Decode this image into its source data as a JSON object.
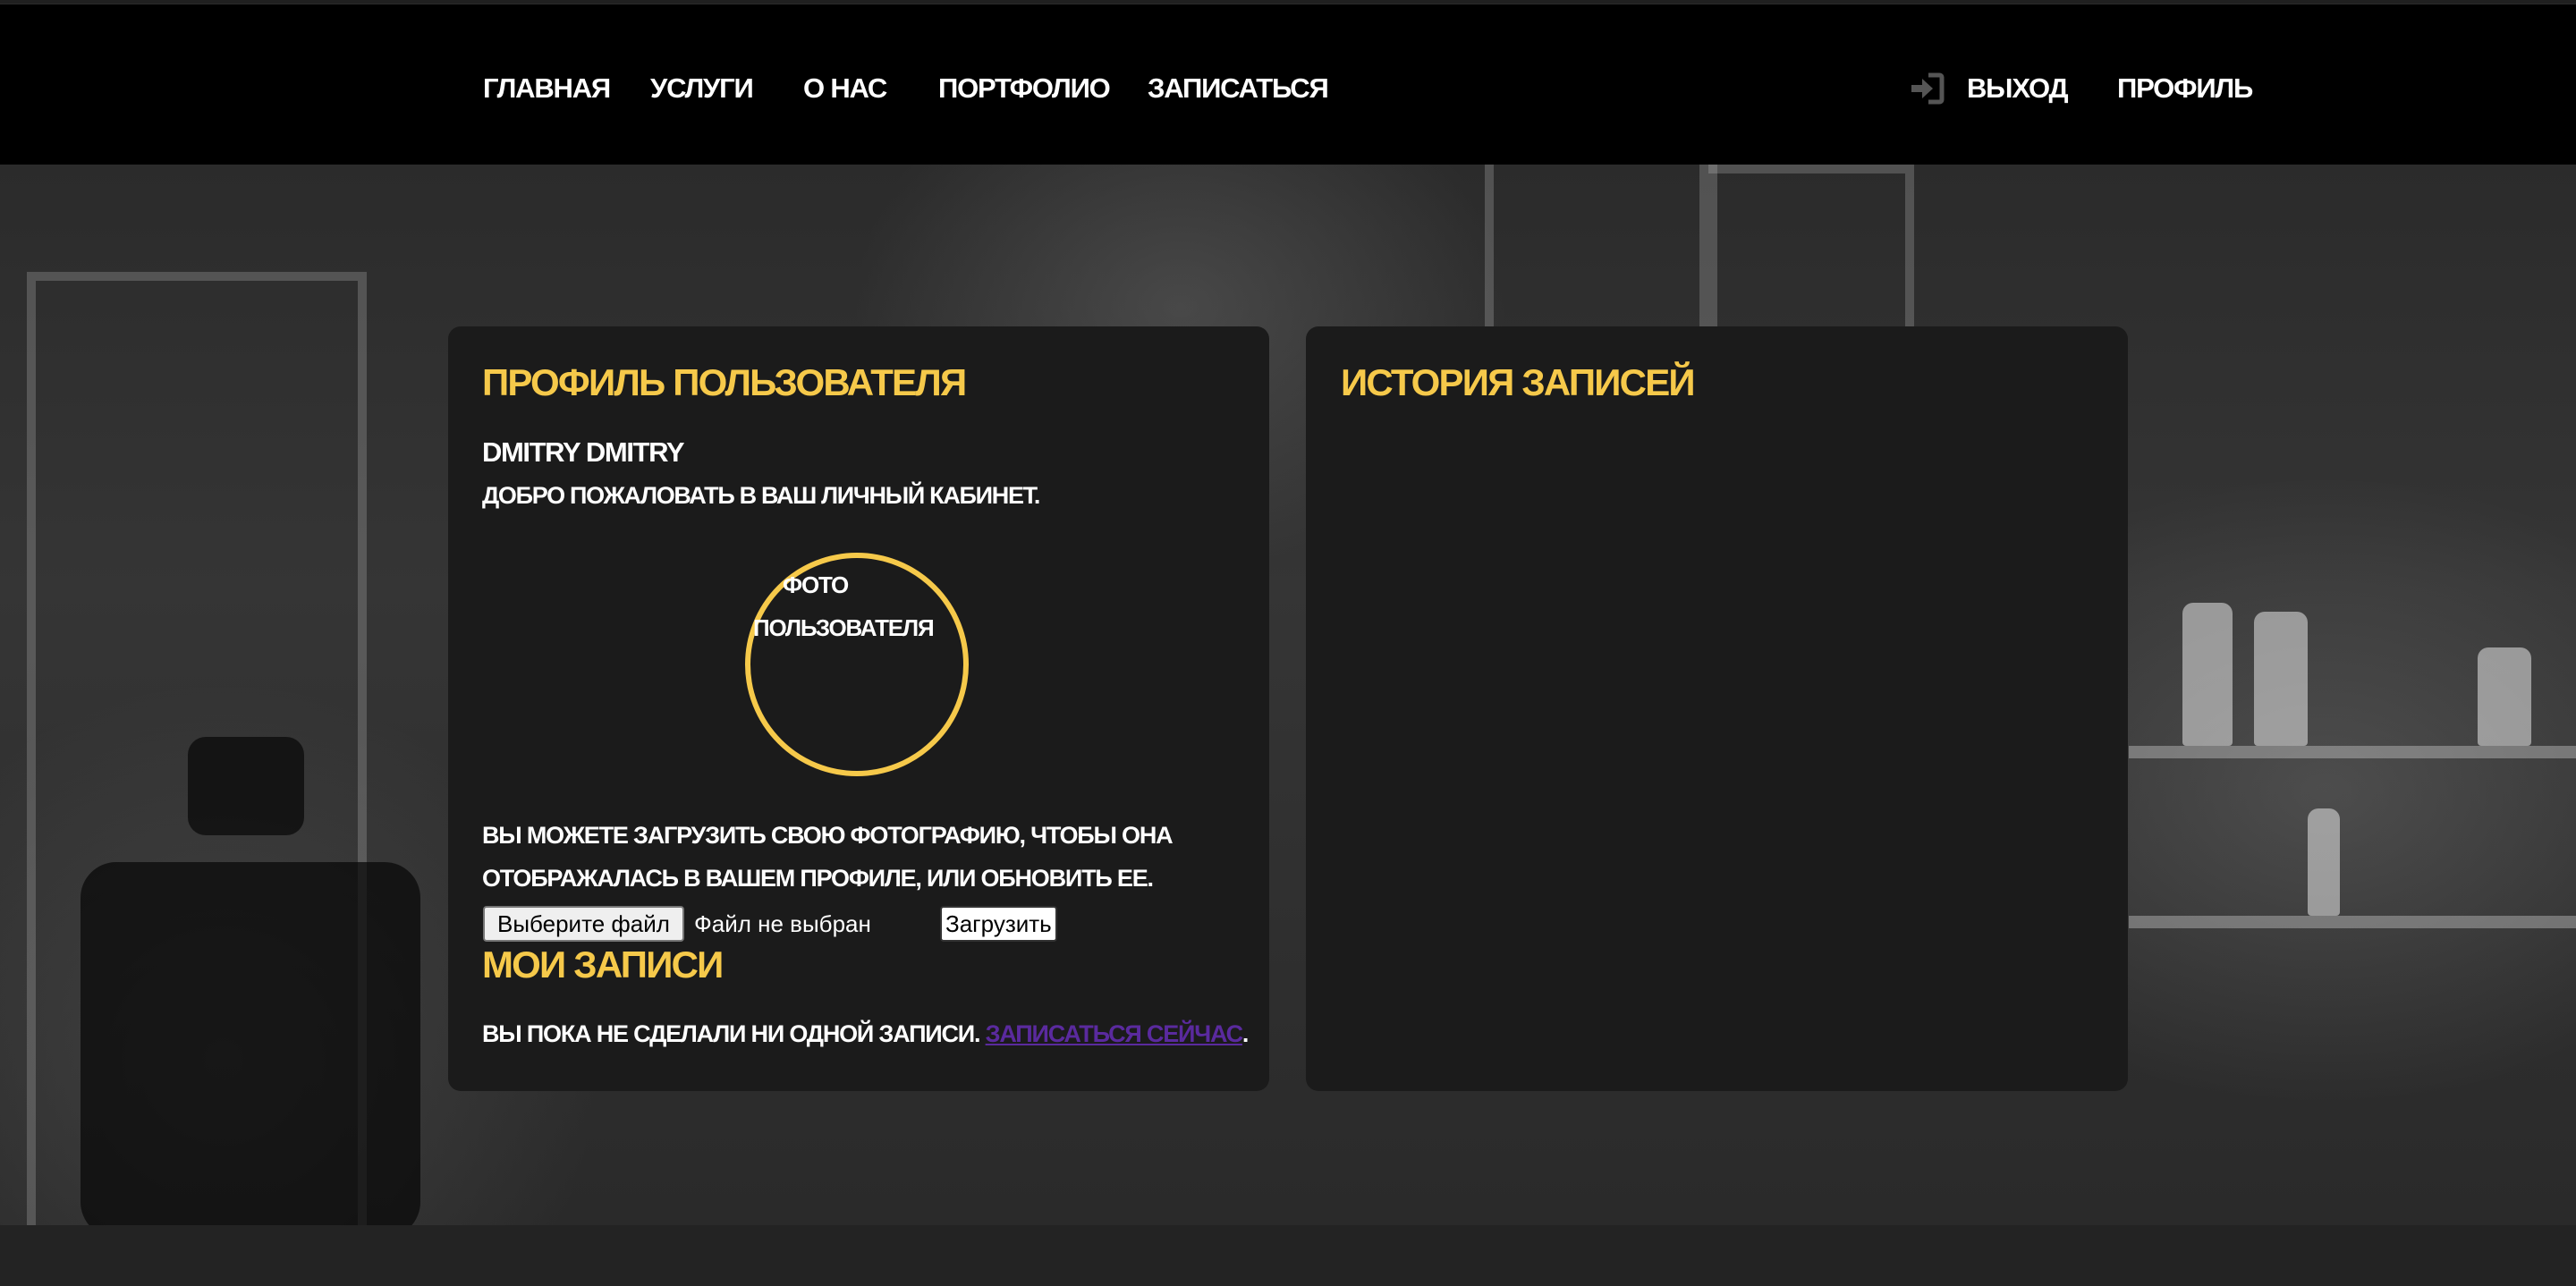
{
  "header": {
    "nav": [
      {
        "label": "ГЛАВНАЯ"
      },
      {
        "label": "УСЛУГИ"
      },
      {
        "label": "О НАС"
      },
      {
        "label": "ПОРТФОЛИО"
      },
      {
        "label": "ЗАПИСАТЬСЯ"
      }
    ],
    "logout_icon": "sign-in-arrow-icon",
    "logout_label": "ВЫХОД",
    "profile_label": "ПРОФИЛЬ"
  },
  "profile_card": {
    "title": "ПРОФИЛЬ ПОЛЬЗОВАТЕЛЯ",
    "user_name": "DMITRY DMITRY",
    "welcome": "ДОБРО ПОЖАЛОВАТЬ В ВАШ ЛИЧНЫЙ КАБИНЕТ.",
    "photo_alt_line1": "ФОТО",
    "photo_alt_line2": "ПОЛЬЗОВАТЕЛЯ",
    "upload_description": "ВЫ МОЖЕТЕ ЗАГРУЗИТЬ СВОЮ ФОТОГРАФИЮ, ЧТОБЫ ОНА ОТОБРАЖАЛАСЬ В ВАШЕМ ПРОФИЛЕ, ИЛИ ОБНОВИТЬ ЕЕ.",
    "choose_file_label": "Выберите файл",
    "no_file_text": "Файл не выбран",
    "upload_label": "Загрузить",
    "my_records_title": "МОИ ЗАПИСИ",
    "no_records_text": "ВЫ ПОКА НЕ СДЕЛАЛИ НИ ОДНОЙ ЗАПИСИ.",
    "book_now_link": "ЗАПИСАТЬСЯ СЕЙЧАС",
    "period": "."
  },
  "history_card": {
    "title": "ИСТОРИЯ ЗАПИСЕЙ"
  },
  "colors": {
    "accent": "#f6c94a",
    "header_bg": "#000000",
    "card_bg": "#1b1b1b",
    "link_visited": "#5a2a9e"
  }
}
